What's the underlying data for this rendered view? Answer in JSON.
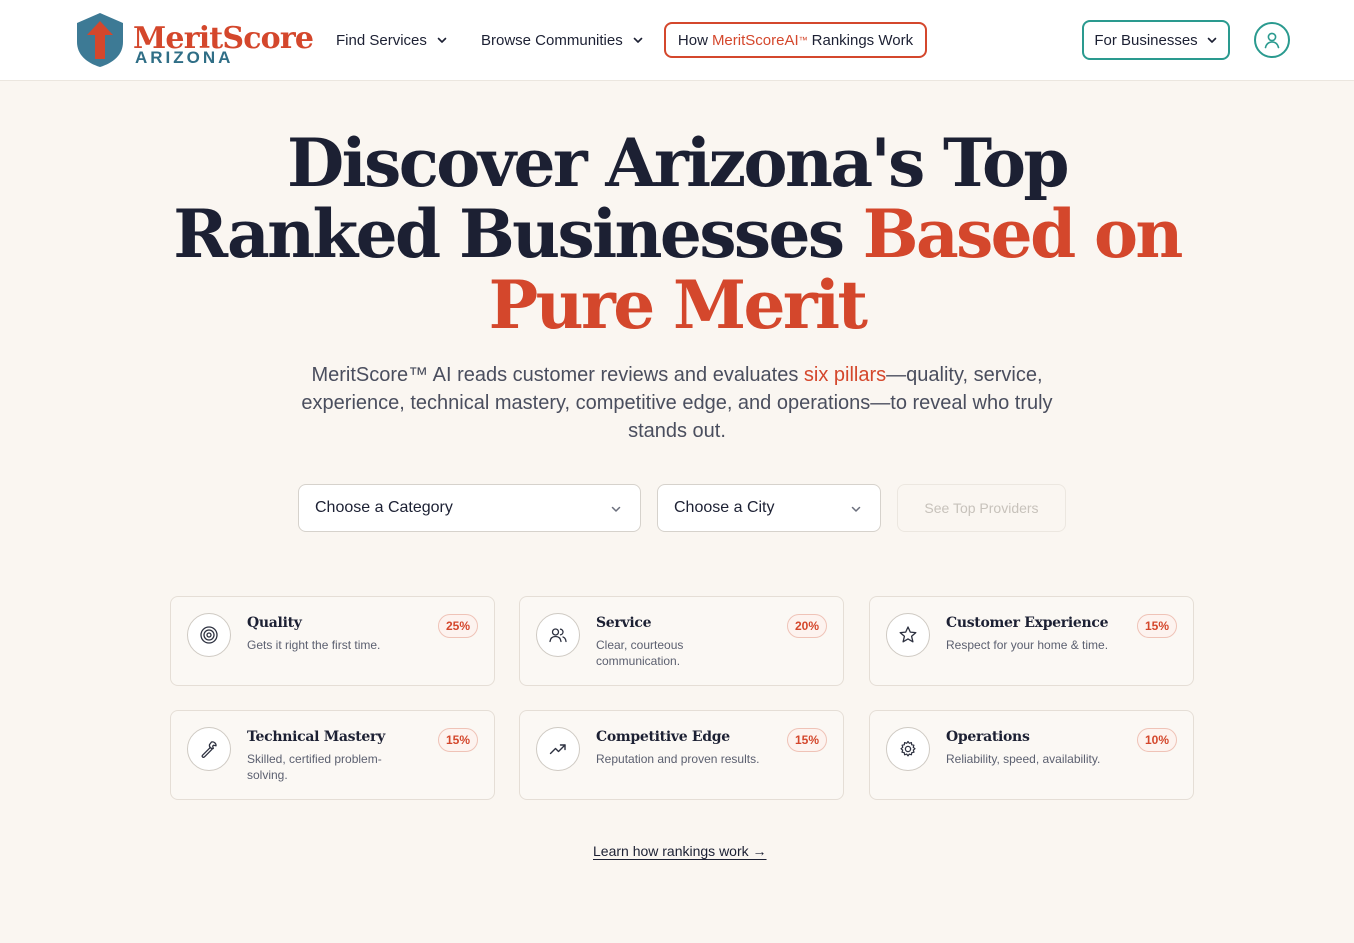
{
  "brand": {
    "name": "MeritScore",
    "subtitle": "ARIZONA",
    "logo_icon": "shield-arrow-logo",
    "colors": {
      "accent": "#d4472c",
      "teal": "#2a9a8f",
      "navy": "#2f6e86"
    }
  },
  "nav": {
    "find_services": "Find Services",
    "browse_communities": "Browse Communities",
    "how_prefix": "How",
    "how_brand": "MeritScoreAI",
    "how_tm": "™",
    "how_suffix": "Rankings Work",
    "for_businesses": "For Businesses",
    "account_icon": "user-icon"
  },
  "hero": {
    "title_line1": "Discover Arizona's Top",
    "title_line2_dark": "Ranked Businesses",
    "title_line2_accent": "Based on",
    "title_line3_accent": "Pure Merit",
    "subtitle_before": "MeritScore™ AI reads customer reviews and evaluates",
    "subtitle_accent": "six pillars",
    "subtitle_after": "—quality, service, experience, technical mastery, competitive edge, and operations—to reveal who truly stands out."
  },
  "search": {
    "category_selected": "Choose a Category",
    "city_selected": "Choose a City",
    "submit_label": "See Top Providers"
  },
  "pillars": [
    {
      "title": "Quality",
      "description": "Gets it right the first time.",
      "weight": "25%",
      "icon": "target-icon"
    },
    {
      "title": "Service",
      "description": "Clear, courteous communication.",
      "weight": "20%",
      "icon": "users-icon"
    },
    {
      "title": "Customer Experience",
      "description": "Respect for your home & time.",
      "weight": "15%",
      "icon": "star-icon"
    },
    {
      "title": "Technical Mastery",
      "description": "Skilled, certified problem-solving.",
      "weight": "15%",
      "icon": "wrench-icon"
    },
    {
      "title": "Competitive Edge",
      "description": "Reputation and proven results.",
      "weight": "15%",
      "icon": "trending-up-icon"
    },
    {
      "title": "Operations",
      "description": "Reliability, speed, availability.",
      "weight": "10%",
      "icon": "gear-icon"
    }
  ],
  "footer_link": "Learn how rankings work →"
}
